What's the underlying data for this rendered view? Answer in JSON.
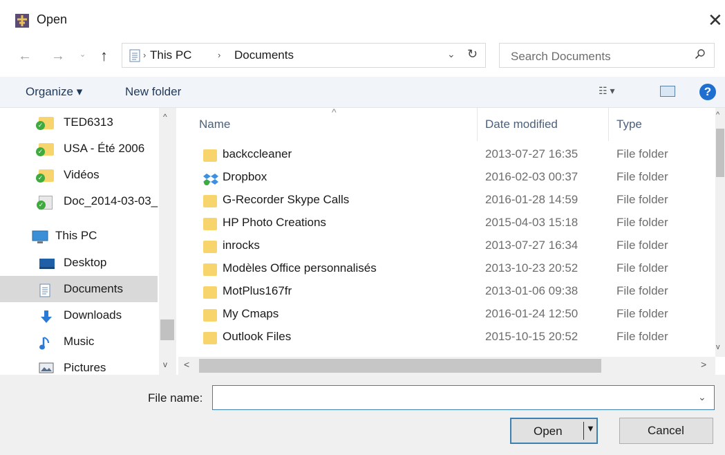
{
  "window": {
    "title": "Open",
    "close_glyph": "✕"
  },
  "nav_buttons": {
    "back": "←",
    "forward": "→",
    "recent": "⌄",
    "up": "↑"
  },
  "address": {
    "crumbs": [
      "This PC",
      "Documents"
    ],
    "separator": "›",
    "dropdown": "⌄",
    "refresh": "↻"
  },
  "search": {
    "placeholder": "Search Documents",
    "value": "",
    "icon_glyph": "⚲"
  },
  "toolbar": {
    "organize_label": "Organize ▾",
    "new_folder_label": "New folder",
    "view_glyph": "☷ ▾",
    "help_glyph": "?"
  },
  "nav_pane": {
    "items": [
      {
        "label": "TED6313",
        "icon": "folder-sync-icon"
      },
      {
        "label": "USA - Été 2006",
        "icon": "folder-sync-icon"
      },
      {
        "label": "Vidéos",
        "icon": "folder-sync-icon"
      },
      {
        "label": "Doc_2014-03-03_",
        "icon": "file-sync-icon"
      },
      {
        "label": "This PC",
        "icon": "computer-icon"
      },
      {
        "label": "Desktop",
        "icon": "desktop-icon"
      },
      {
        "label": "Documents",
        "icon": "documents-icon",
        "selected": true
      },
      {
        "label": "Downloads",
        "icon": "downloads-icon"
      },
      {
        "label": "Music",
        "icon": "music-icon"
      },
      {
        "label": "Pictures",
        "icon": "pictures-icon"
      }
    ],
    "scroll_up": "^",
    "scroll_down": "v"
  },
  "file_list": {
    "columns": {
      "name": "Name",
      "date": "Date modified",
      "type": "Type"
    },
    "sort_indicator": "^",
    "rows": [
      {
        "name": "backccleaner",
        "date": "2013-07-27 16:35",
        "type": "File folder",
        "icon": "folder-icon"
      },
      {
        "name": "Dropbox",
        "date": "2016-02-03 00:37",
        "type": "File folder",
        "icon": "dropbox-icon"
      },
      {
        "name": "G-Recorder Skype Calls",
        "date": "2016-01-28 14:59",
        "type": "File folder",
        "icon": "folder-icon"
      },
      {
        "name": "HP Photo Creations",
        "date": "2015-04-03 15:18",
        "type": "File folder",
        "icon": "folder-icon"
      },
      {
        "name": "inrocks",
        "date": "2013-07-27 16:34",
        "type": "File folder",
        "icon": "folder-icon"
      },
      {
        "name": "Modèles Office personnalisés",
        "date": "2013-10-23 20:52",
        "type": "File folder",
        "icon": "folder-icon"
      },
      {
        "name": "MotPlus167fr",
        "date": "2013-01-06 09:38",
        "type": "File folder",
        "icon": "folder-icon"
      },
      {
        "name": "My Cmaps",
        "date": "2016-01-24 12:50",
        "type": "File folder",
        "icon": "folder-icon"
      },
      {
        "name": "Outlook Files",
        "date": "2015-10-15 20:52",
        "type": "File folder",
        "icon": "folder-icon"
      }
    ],
    "scroll_up": "^",
    "scroll_down": "v",
    "scroll_left": "<",
    "scroll_right": ">"
  },
  "bottom": {
    "file_name_label": "File name:",
    "file_name_value": "",
    "dropdown": "⌄",
    "open_label": "Open",
    "open_arrow": "▼",
    "cancel_label": "Cancel"
  },
  "colors": {
    "accent": "#3c7fb1",
    "help": "#1f6fd1",
    "folder": "#f7d56c",
    "selected": "#d9d9d9"
  }
}
